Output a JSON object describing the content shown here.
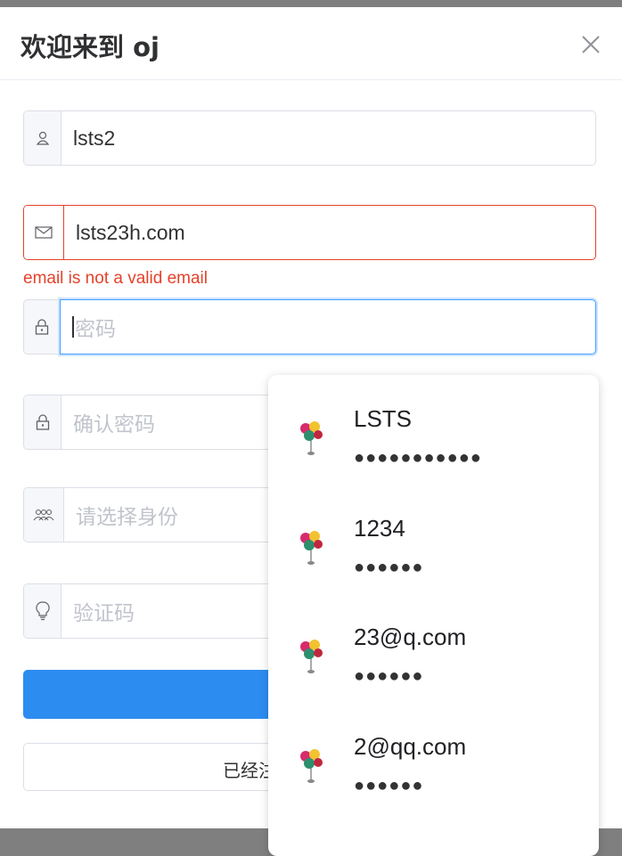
{
  "dialog": {
    "title": "欢迎来到 oj"
  },
  "form": {
    "username": {
      "value": "lsts2",
      "icon": "user-icon"
    },
    "email": {
      "value": "lsts23h.com",
      "icon": "mail-icon",
      "error": "email is not a valid email"
    },
    "password": {
      "placeholder": "密码",
      "icon": "lock-icon"
    },
    "confirm_password": {
      "placeholder": "确认密码",
      "icon": "lock-icon"
    },
    "identity": {
      "placeholder": "请选择身份",
      "icon": "users-icon"
    },
    "captcha": {
      "placeholder": "验证码",
      "icon": "bulb-icon"
    },
    "secondary_button_label": "已经注"
  },
  "saved_credentials": [
    {
      "username": "LSTS",
      "password_mask": "●●●●●●●●●●●"
    },
    {
      "username": "1234",
      "password_mask": "●●●●●●"
    },
    {
      "username": "23@q.com",
      "password_mask": "●●●●●●"
    },
    {
      "username": "2@qq.com",
      "password_mask": "●●●●●●"
    }
  ],
  "colors": {
    "primary": "#2d8cf0",
    "error": "#e5412a",
    "focus": "#409eff"
  }
}
